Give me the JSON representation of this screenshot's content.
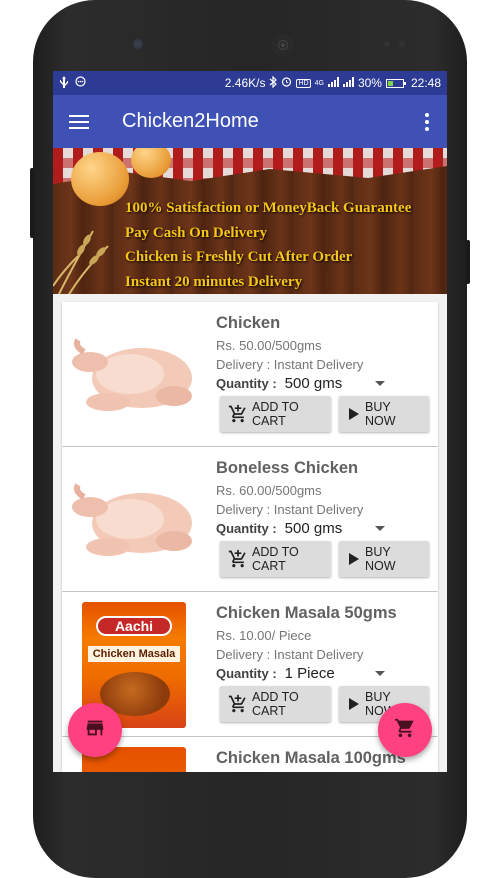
{
  "status_bar": {
    "network_speed": "2.46K/s",
    "network_type": "4G",
    "battery_percent": "30%",
    "time": "22:48"
  },
  "app_bar": {
    "title": "Chicken2Home",
    "menu_icon": "hamburger-menu-icon",
    "overflow_icon": "more-vert-icon",
    "color": "#3f51b5"
  },
  "banner": {
    "lines": [
      "100% Satisfaction or MoneyBack Guarantee",
      "Pay Cash On Delivery",
      "Chicken is Freshly Cut After Order",
      "Instant 20 minutes Delivery"
    ]
  },
  "labels": {
    "delivery_prefix": "Delivery : ",
    "quantity_label": "Quantity :",
    "add_to_cart": "ADD TO CART",
    "buy_now": "BUY NOW"
  },
  "products": [
    {
      "name": "Chicken",
      "price": "Rs. 50.00/500gms",
      "delivery": "Instant Delivery",
      "quantity": "500 gms",
      "image": "raw-chicken"
    },
    {
      "name": "Boneless Chicken",
      "price": "Rs. 60.00/500gms",
      "delivery": "Instant Delivery",
      "quantity": "500 gms",
      "image": "raw-chicken"
    },
    {
      "name": "Chicken Masala 50gms",
      "price": "Rs. 10.00/ Piece",
      "delivery": "Instant Delivery",
      "quantity": "1 Piece",
      "image": "aachi-masala-pack",
      "pack_brand": "Aachi",
      "pack_product": "Chicken Masala"
    },
    {
      "name": "Chicken Masala 100gms"
    }
  ],
  "fabs": {
    "store_icon": "store-icon",
    "cart_icon": "shopping-cart-icon",
    "color": "#ff4081"
  }
}
